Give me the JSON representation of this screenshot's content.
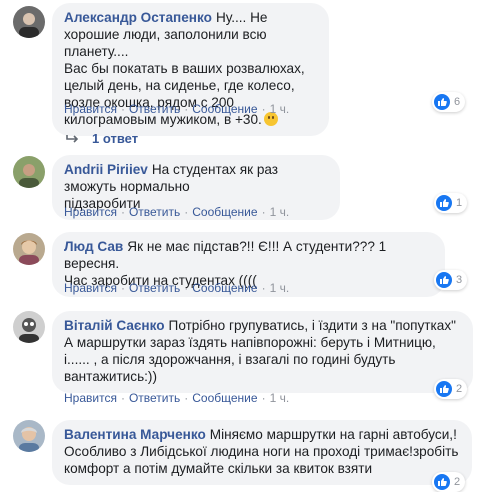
{
  "comments": [
    {
      "author": "Александр Остапенко",
      "text": "Ну.... Не хорошие люди, заполонили всю планету....\nВас бы покатать в ваших розвалюхах, целый день, на сиденье, где колесо, возле окошка, рядом с 200 килограмовым мужиком, в +30.",
      "emoji": "smile-emoji",
      "actions": {
        "like": "Нравится",
        "reply": "Ответить",
        "message": "Сообщение",
        "time": "1 ч."
      },
      "reaction_count": "6"
    },
    {
      "author": "Andrii Piriiev",
      "text": "На студентах як раз зможуть нормально\nпідзаробити",
      "actions": {
        "like": "Нравится",
        "reply": "Ответить",
        "message": "Сообщение",
        "time": "1 ч."
      },
      "reaction_count": "1"
    },
    {
      "author": "Люд Сав",
      "text": "Як не має підстав?!! Є!!! А студенти??? 1 вересня.\nЧас заробити на студентах ((((",
      "actions": {
        "like": "Нравится",
        "reply": "Ответить",
        "message": "Сообщение",
        "time": "1 ч."
      },
      "reaction_count": "3"
    },
    {
      "author": "Віталій Саєнко",
      "text": "Потрібно групуватись, і їздити з на \"попутках\"\nА маршрутки зараз їздять напівпорожні: беруть і Митницю,\nі...... , а після здорожчання, і взагалі по годині будуть\nвантажитись:))",
      "actions": {
        "like": "Нравится",
        "reply": "Ответить",
        "message": "Сообщение",
        "time": "1 ч."
      },
      "reaction_count": "2"
    },
    {
      "author": "Валентина Марченко",
      "text": "Міняємо маршрутки на гарні автобуси,!\nОсобливо з Либідської людина ноги на проході тримає!зробіть\nкомфорт а потім думайте скільки за квиток взяти",
      "reaction_count": "2"
    }
  ],
  "replies_label": "1 ответ",
  "icons": {
    "like": "like-icon",
    "reply_arrow": "reply-arrow-icon"
  },
  "colors": {
    "name": "#385898",
    "bubble": "#f2f3f5",
    "like": "#1877f2",
    "meta": "#90949c"
  }
}
